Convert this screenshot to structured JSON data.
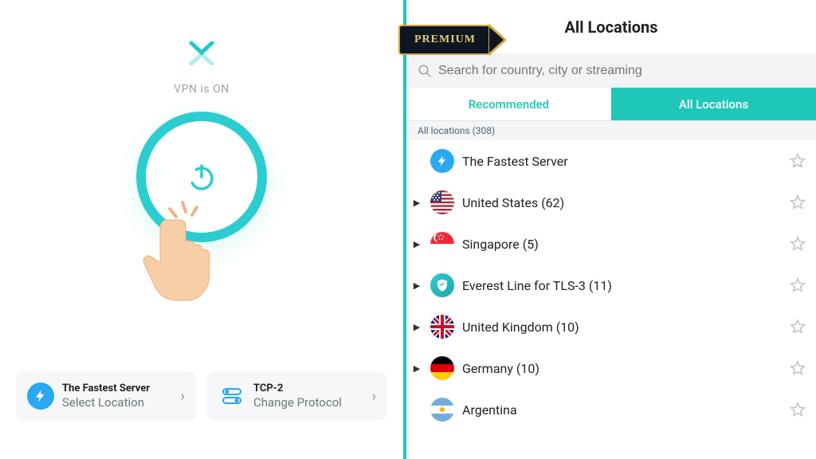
{
  "left": {
    "status": "VPN is ON",
    "server_card": {
      "title": "The Fastest Server",
      "action": "Select Location"
    },
    "protocol_card": {
      "title": "TCP-2",
      "action": "Change Protocol"
    }
  },
  "right": {
    "premium_label": "PREMIUM",
    "title": "All Locations",
    "search_placeholder": "Search for country, city or streaming",
    "tab_recommended": "Recommended",
    "tab_all": "All Locations",
    "section_header": "All locations (308)",
    "rows": [
      {
        "label": "The Fastest Server",
        "expandable": false,
        "icon": "bolt"
      },
      {
        "label": "United States (62)",
        "expandable": true,
        "icon": "flag-us"
      },
      {
        "label": "Singapore (5)",
        "expandable": true,
        "icon": "flag-sg"
      },
      {
        "label": "Everest Line for TLS-3 (11)",
        "expandable": true,
        "icon": "shield"
      },
      {
        "label": "United Kingdom (10)",
        "expandable": true,
        "icon": "flag-uk"
      },
      {
        "label": "Germany (10)",
        "expandable": true,
        "icon": "flag-de"
      },
      {
        "label": "Argentina",
        "expandable": false,
        "icon": "flag-ar"
      }
    ]
  },
  "colors": {
    "accent": "#1ec7b7",
    "power_ring": "#2ccdd0",
    "blue": "#2aa8f2"
  }
}
